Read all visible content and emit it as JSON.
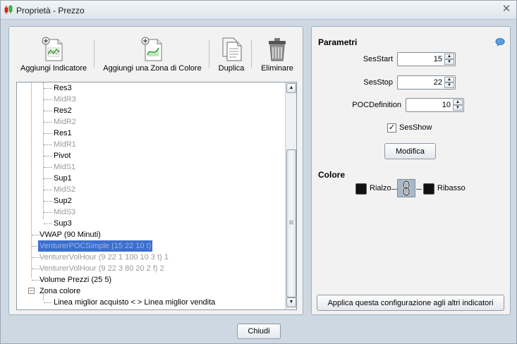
{
  "window": {
    "title": "Proprietà - Prezzo",
    "close_symbol": "✕"
  },
  "toolbar": {
    "add_indicator": "Aggiungi Indicatore",
    "add_color_zone": "Aggiungi una Zona di Colore",
    "duplicate": "Duplica",
    "delete": "Eliminare"
  },
  "tree": {
    "items": [
      {
        "label": "Res3",
        "dim": false
      },
      {
        "label": "MidR3",
        "dim": true
      },
      {
        "label": "Res2",
        "dim": false
      },
      {
        "label": "MidR2",
        "dim": true
      },
      {
        "label": "Res1",
        "dim": false
      },
      {
        "label": "MidR1",
        "dim": true
      },
      {
        "label": "Pivot",
        "dim": false
      },
      {
        "label": "MidS1",
        "dim": true
      },
      {
        "label": "Sup1",
        "dim": false
      },
      {
        "label": "MidS2",
        "dim": true
      },
      {
        "label": "Sup2",
        "dim": false
      },
      {
        "label": "MidS3",
        "dim": true
      },
      {
        "label": "Sup3",
        "dim": false
      }
    ],
    "top_items": [
      {
        "label": "VWAP (90 Minuti)",
        "dim": false
      },
      {
        "label": "VenturerPOCSimple (15 22 10 t)",
        "dim": true,
        "selected": true
      },
      {
        "label": "VenturerVolHour (9 22 1 100 10 3 t) 1",
        "dim": true
      },
      {
        "label": "VenturerVolHour (9 22 3 80 20 2 f) 2",
        "dim": true
      },
      {
        "label": "Volume Prezzi (25 5)",
        "dim": false
      },
      {
        "label": "Zona colore",
        "dim": false,
        "expander": "−"
      }
    ],
    "zone_child": "Linea miglior acquisto < > Linea miglior vendita"
  },
  "parameters": {
    "title": "Parametri",
    "ses_start_label": "SesStart",
    "ses_start_value": "15",
    "ses_stop_label": "SesStop",
    "ses_stop_value": "22",
    "poc_def_label": "POCDefinition",
    "poc_def_value": "10",
    "ses_show_label": "SesShow",
    "ses_show_checked": true,
    "modify_button": "Modifica"
  },
  "colors": {
    "title": "Colore",
    "up_label": "Rialzo",
    "down_label": "Ribasso",
    "up_color": "#111111",
    "down_color": "#111111"
  },
  "apply_button": "Applica questa configurazione agli altri indicatori",
  "close_button": "Chiudi",
  "icons": {
    "spin_up": "▲",
    "spin_down": "▼",
    "check": "✓"
  }
}
